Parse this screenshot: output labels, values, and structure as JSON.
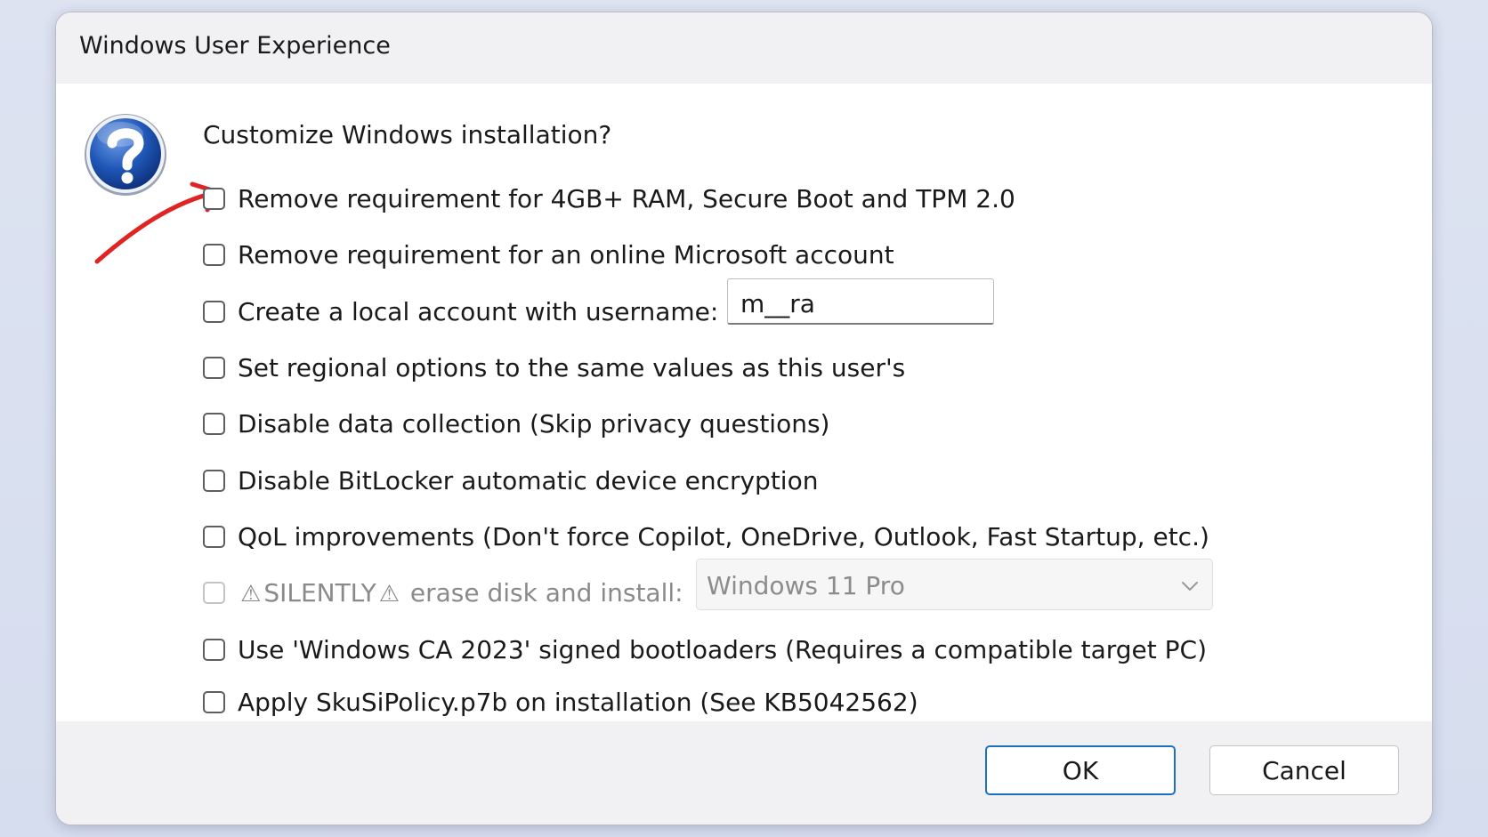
{
  "window": {
    "title": "Windows User Experience"
  },
  "icons": {
    "question": "question-mark-icon",
    "warning": "warning-triangle-icon",
    "dropdown": "chevron-down-icon"
  },
  "dialog": {
    "heading": "Customize Windows installation?",
    "options": [
      {
        "label": "Remove requirement for 4GB+ RAM, Secure Boot and TPM 2.0",
        "checked": false,
        "enabled": true
      },
      {
        "label": "Remove requirement for an online Microsoft account",
        "checked": false,
        "enabled": true
      },
      {
        "label": "Create a local account with username:",
        "checked": false,
        "enabled": true
      },
      {
        "label": "Set regional options to the same values as this user's",
        "checked": false,
        "enabled": true
      },
      {
        "label": "Disable data collection (Skip privacy questions)",
        "checked": false,
        "enabled": true
      },
      {
        "label": "Disable BitLocker automatic device encryption",
        "checked": false,
        "enabled": true
      },
      {
        "label": "QoL improvements (Don't force Copilot, OneDrive, Outlook, Fast Startup, etc.)",
        "checked": false,
        "enabled": true
      },
      {
        "label_main": "SILENTLY",
        "label_rest": " erase disk and install:",
        "warn_glyph": "⚠",
        "checked": false,
        "enabled": false
      },
      {
        "label": "Use 'Windows CA 2023' signed bootloaders (Requires a compatible target PC)",
        "checked": false,
        "enabled": true
      },
      {
        "label": "Apply SkuSiPolicy.p7b on installation (See KB5042562)",
        "checked": false,
        "enabled": true
      }
    ],
    "username_value": "m__ra",
    "edition_selected": "Windows 11 Pro"
  },
  "buttons": {
    "ok": "OK",
    "cancel": "Cancel"
  },
  "colors": {
    "accent": "#1f6fbf",
    "arrow": "#e02424",
    "icon_blue": "#1c4fa8"
  }
}
